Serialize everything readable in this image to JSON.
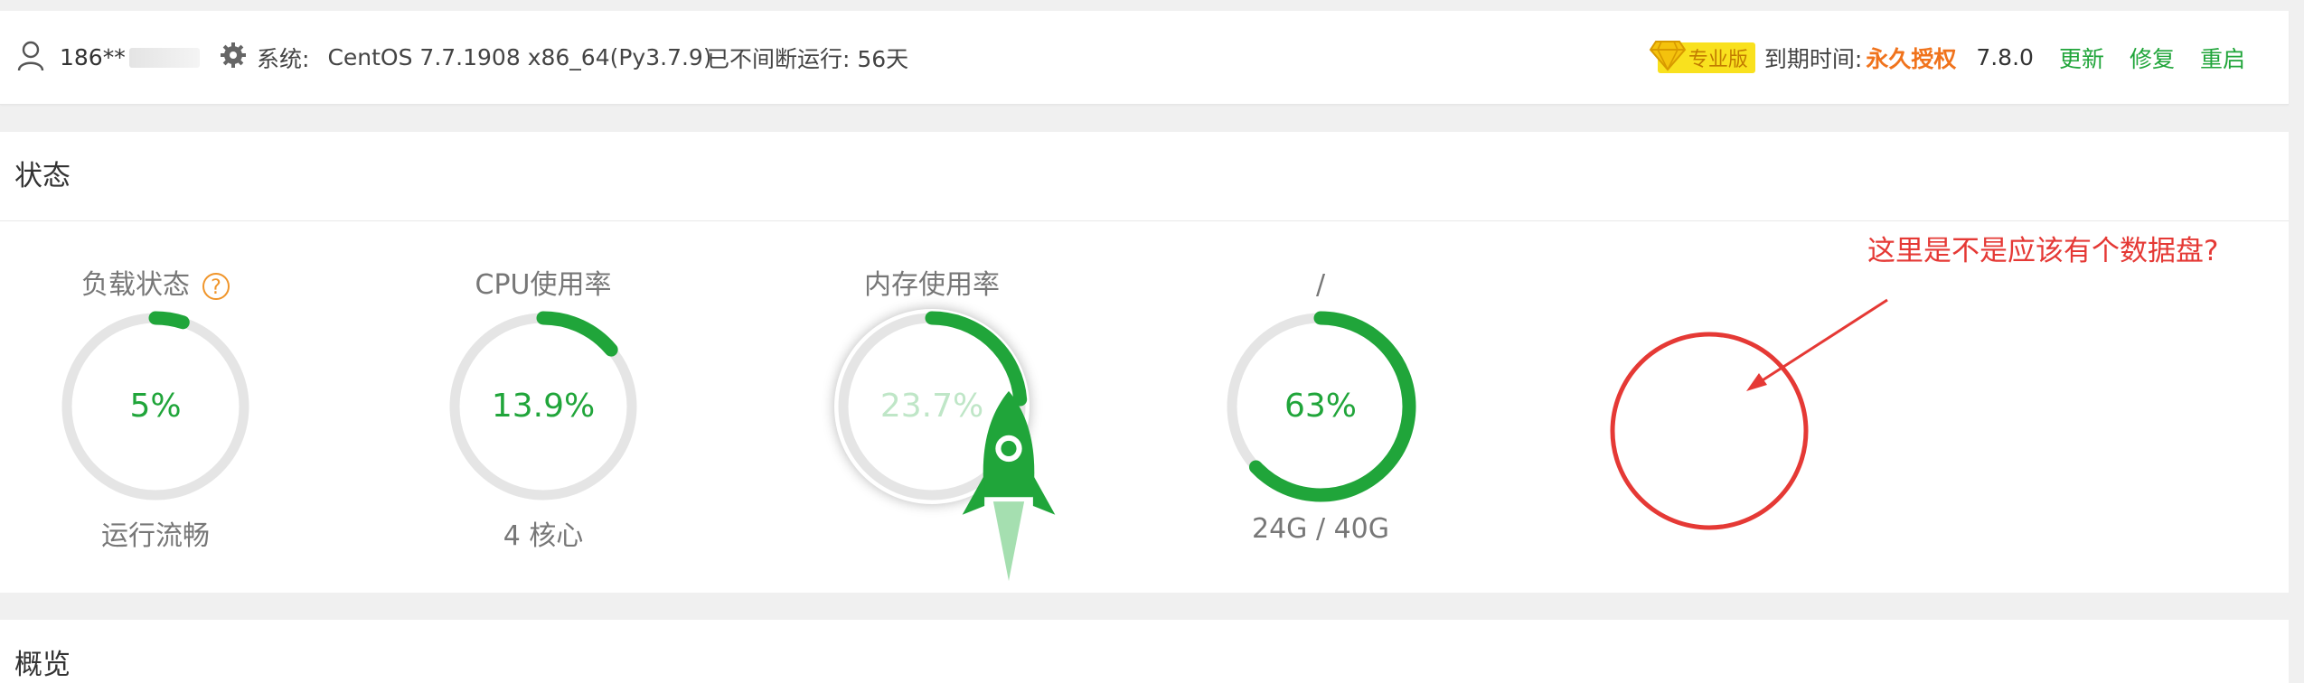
{
  "topbar": {
    "username": "186**",
    "system_label": "系统:",
    "system_value": "CentOS 7.7.1908 x86_64(Py3.7.9)",
    "uptime": "已不间断运行: 56天",
    "pro_label": "专业版",
    "expire_label": "到期时间:",
    "expire_value": "永久授权",
    "version": "7.8.0",
    "update": "更新",
    "repair": "修复",
    "restart": "重启",
    "accent_color": "#20a53a",
    "warning_color": "#f0731c"
  },
  "status": {
    "title": "状态",
    "gauges": [
      {
        "title": "负载状态",
        "value": "5%",
        "percent": 5,
        "footer": "运行流畅"
      },
      {
        "title": "CPU使用率",
        "value": "13.9%",
        "percent": 13.9,
        "footer": "4 核心"
      },
      {
        "title": "内存使用率",
        "value": "23.7%",
        "percent": 23.7,
        "footer": ""
      },
      {
        "title": "/",
        "value": "63%",
        "percent": 63,
        "footer": "24G / 40G"
      }
    ]
  },
  "annotation": {
    "text": "这里是不是应该有个数据盘?",
    "color": "#e53935"
  },
  "overview": {
    "title": "概览"
  },
  "icons": [
    "user-icon",
    "gear-icon",
    "diamond-icon",
    "help-icon",
    "rocket-icon"
  ]
}
